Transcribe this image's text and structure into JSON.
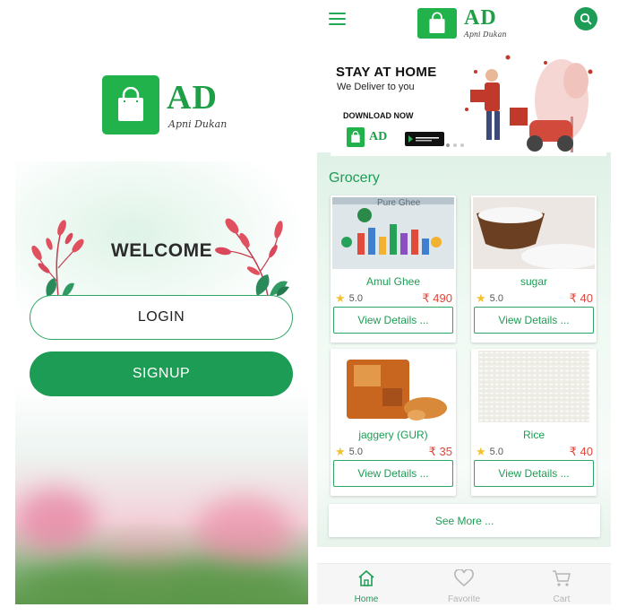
{
  "login_screen": {
    "logo": {
      "ad": "AD",
      "subtitle": "Apni Dukan"
    },
    "welcome": "WELCOME",
    "login_label": "LOGIN",
    "signup_label": "SIGNUP"
  },
  "home_screen": {
    "header": {
      "logo_ad": "AD",
      "logo_subtitle": "Apni Dukan"
    },
    "banner": {
      "headline": "STAY AT HOME",
      "subline": "We Deliver to you",
      "cta": "DOWNLOAD NOW",
      "mini_logo": "AD"
    },
    "section_title": "Grocery",
    "products": [
      {
        "name": "Amul Ghee",
        "rating": "5.0",
        "price": "₹ 490",
        "action": "View Details ...",
        "img_text": "Pure Ghee"
      },
      {
        "name": "sugar",
        "rating": "5.0",
        "price": "₹ 40",
        "action": "View Details ..."
      },
      {
        "name": "jaggery (GUR)",
        "rating": "5.0",
        "price": "₹ 35",
        "action": "View Details ..."
      },
      {
        "name": "Rice",
        "rating": "5.0",
        "price": "₹ 40",
        "action": "View Details ..."
      }
    ],
    "see_more": "See More ...",
    "nav": [
      {
        "label": "Home",
        "icon": "home-icon",
        "active": true
      },
      {
        "label": "Favorite",
        "icon": "heart-icon",
        "active": false
      },
      {
        "label": "Cart",
        "icon": "cart-icon",
        "active": false
      }
    ]
  },
  "colors": {
    "brand_green": "#1d9c55",
    "price_red": "#e0473a",
    "star": "#f2c230"
  }
}
